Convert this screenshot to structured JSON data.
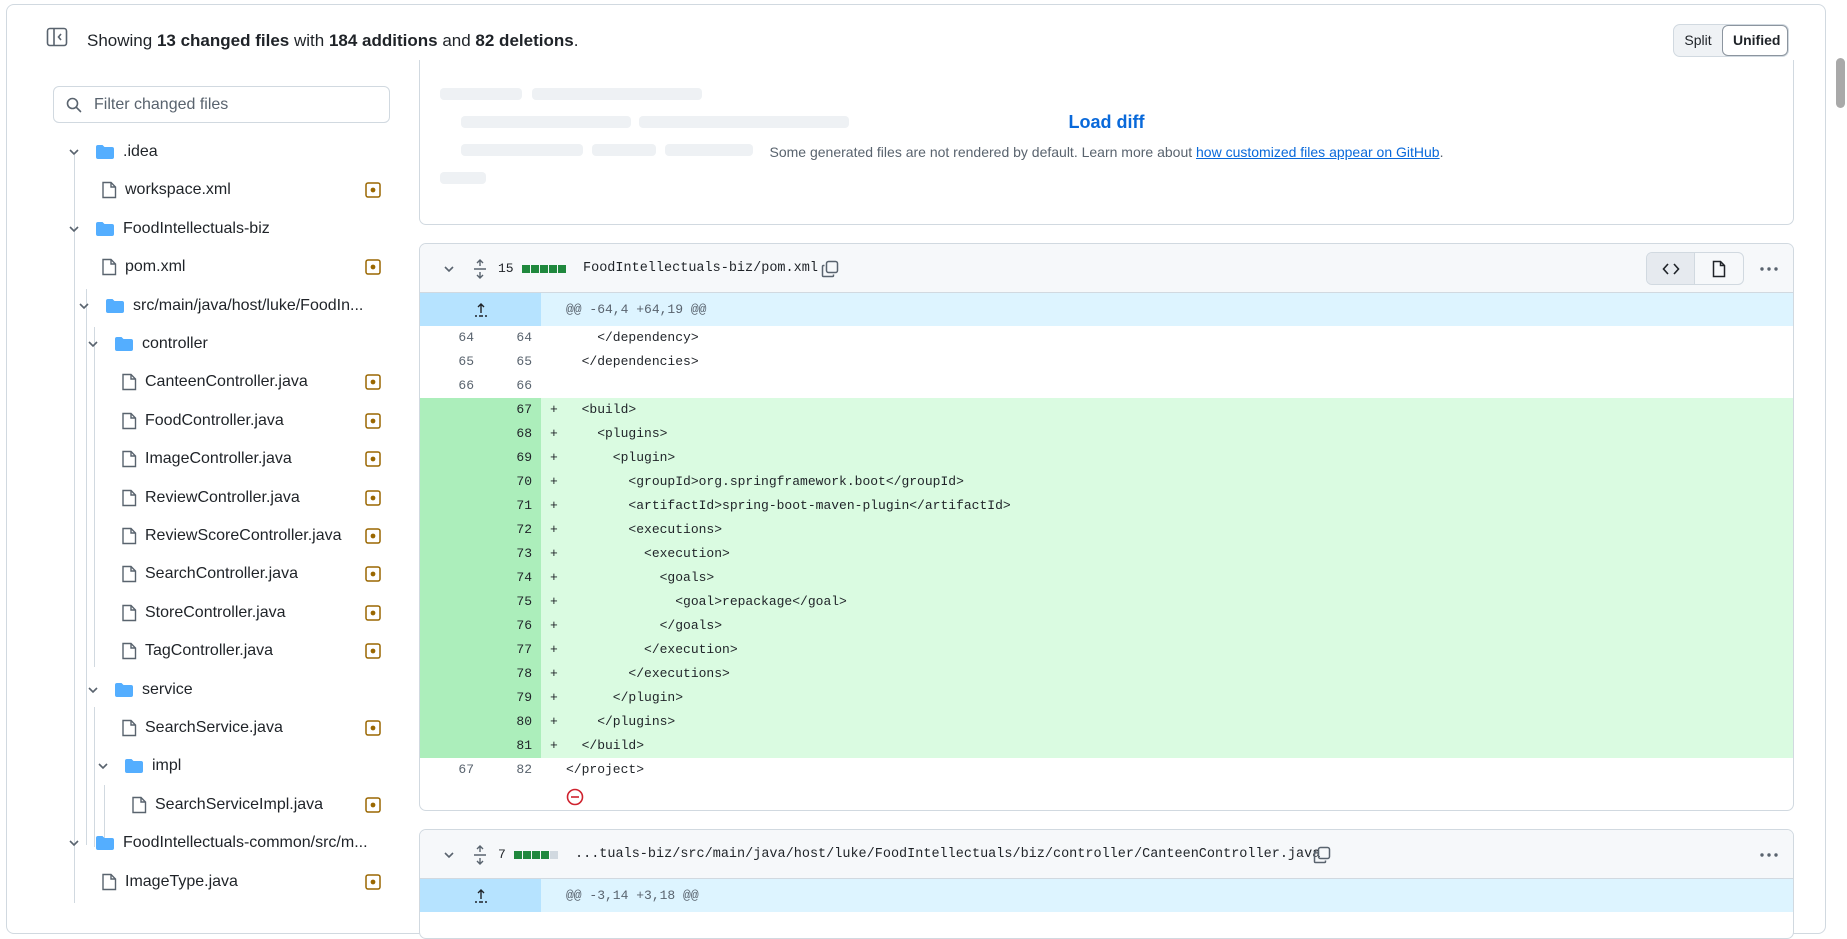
{
  "summary": {
    "prefix": "Showing",
    "files": "13 changed files",
    "with": "with",
    "additions": "184 additions",
    "and": "and",
    "deletions": "82 deletions",
    "suffix": "."
  },
  "view_toggle": {
    "split": "Split",
    "unified": "Unified",
    "selected": "Unified"
  },
  "filter": {
    "placeholder": "Filter changed files",
    "value": ""
  },
  "tree": [
    {
      "label": ".idea",
      "type": "folder",
      "expanded": true
    },
    {
      "label": "workspace.xml",
      "type": "file",
      "status": "modified"
    },
    {
      "label": "FoodIntellectuals-biz",
      "type": "folder",
      "expanded": true
    },
    {
      "label": "pom.xml",
      "type": "file",
      "status": "modified"
    },
    {
      "label": "src/main/java/host/luke/FoodIn...",
      "type": "folder",
      "expanded": true
    },
    {
      "label": "controller",
      "type": "folder",
      "expanded": true
    },
    {
      "label": "CanteenController.java",
      "type": "file",
      "status": "modified"
    },
    {
      "label": "FoodController.java",
      "type": "file",
      "status": "modified"
    },
    {
      "label": "ImageController.java",
      "type": "file",
      "status": "modified"
    },
    {
      "label": "ReviewController.java",
      "type": "file",
      "status": "modified"
    },
    {
      "label": "ReviewScoreController.java",
      "type": "file",
      "status": "modified"
    },
    {
      "label": "SearchController.java",
      "type": "file",
      "status": "modified"
    },
    {
      "label": "StoreController.java",
      "type": "file",
      "status": "modified"
    },
    {
      "label": "TagController.java",
      "type": "file",
      "status": "modified"
    },
    {
      "label": "service",
      "type": "folder",
      "expanded": true
    },
    {
      "label": "SearchService.java",
      "type": "file",
      "status": "modified"
    },
    {
      "label": "impl",
      "type": "folder",
      "expanded": true
    },
    {
      "label": "SearchServiceImpl.java",
      "type": "file",
      "status": "modified"
    },
    {
      "label": "FoodIntellectuals-common/src/m...",
      "type": "folder",
      "expanded": true
    },
    {
      "label": "ImageType.java",
      "type": "file",
      "status": "modified"
    }
  ],
  "generated_file": {
    "load_diff": "Load diff",
    "note_text": "Some generated files are not rendered by default. Learn more about",
    "note_link": "how customized files appear on GitHub",
    "note_end": "."
  },
  "file1": {
    "changes": "15",
    "diffstat": [
      "add",
      "add",
      "add",
      "add",
      "add"
    ],
    "path": "FoodIntellectuals-biz/pom.xml",
    "hunk": "@@ -64,4 +64,19 @@",
    "lines": [
      {
        "old": "64",
        "new": "64",
        "sign": "",
        "type": "ctx",
        "code": "    </dependency>"
      },
      {
        "old": "65",
        "new": "65",
        "sign": "",
        "type": "ctx",
        "code": "  </dependencies>"
      },
      {
        "old": "66",
        "new": "66",
        "sign": "",
        "type": "ctx",
        "code": ""
      },
      {
        "old": "",
        "new": "67",
        "sign": "+",
        "type": "add",
        "code": "  <build>"
      },
      {
        "old": "",
        "new": "68",
        "sign": "+",
        "type": "add",
        "code": "    <plugins>"
      },
      {
        "old": "",
        "new": "69",
        "sign": "+",
        "type": "add",
        "code": "      <plugin>"
      },
      {
        "old": "",
        "new": "70",
        "sign": "+",
        "type": "add",
        "code": "        <groupId>org.springframework.boot</groupId>"
      },
      {
        "old": "",
        "new": "71",
        "sign": "+",
        "type": "add",
        "code": "        <artifactId>spring-boot-maven-plugin</artifactId>"
      },
      {
        "old": "",
        "new": "72",
        "sign": "+",
        "type": "add",
        "code": "        <executions>"
      },
      {
        "old": "",
        "new": "73",
        "sign": "+",
        "type": "add",
        "code": "          <execution>"
      },
      {
        "old": "",
        "new": "74",
        "sign": "+",
        "type": "add",
        "code": "            <goals>"
      },
      {
        "old": "",
        "new": "75",
        "sign": "+",
        "type": "add",
        "code": "              <goal>repackage</goal>"
      },
      {
        "old": "",
        "new": "76",
        "sign": "+",
        "type": "add",
        "code": "            </goals>"
      },
      {
        "old": "",
        "new": "77",
        "sign": "+",
        "type": "add",
        "code": "          </execution>"
      },
      {
        "old": "",
        "new": "78",
        "sign": "+",
        "type": "add",
        "code": "        </executions>"
      },
      {
        "old": "",
        "new": "79",
        "sign": "+",
        "type": "add",
        "code": "      </plugin>"
      },
      {
        "old": "",
        "new": "80",
        "sign": "+",
        "type": "add",
        "code": "    </plugins>"
      },
      {
        "old": "",
        "new": "81",
        "sign": "+",
        "type": "add",
        "code": "  </build>"
      },
      {
        "old": "67",
        "new": "82",
        "sign": "",
        "type": "ctx",
        "code": "</project>"
      }
    ]
  },
  "file2": {
    "changes": "7",
    "diffstat": [
      "add",
      "add",
      "add",
      "add",
      "neu"
    ],
    "path": "...tuals-biz/src/main/java/host/luke/FoodIntellectuals/biz/controller/CanteenController.java",
    "hunk": "@@ -3,14 +3,18 @@"
  },
  "colors": {
    "accent": "#0969da",
    "addition_bg": "#dafbe1",
    "addition_gutter": "#aceebb",
    "hunk_bg": "#ddf4ff",
    "modified_icon": "#9a6700",
    "folder_icon": "#54aeff"
  }
}
